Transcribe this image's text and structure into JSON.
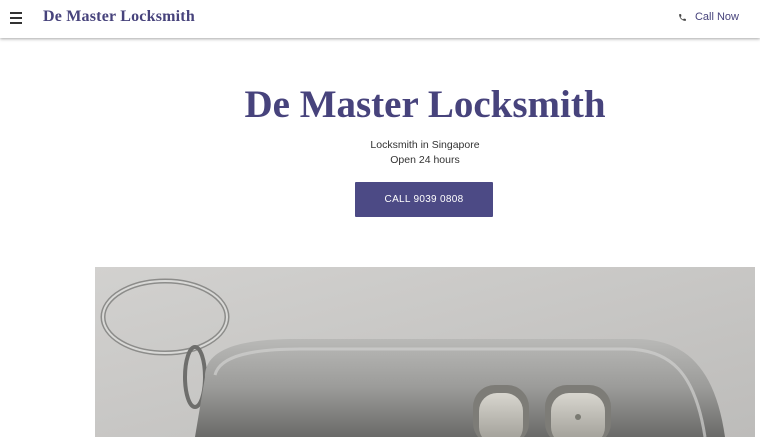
{
  "header": {
    "brand": "De Master Locksmith",
    "call_label": "Call Now",
    "menu_icon": "hamburger-menu-icon",
    "phone_icon": "phone-icon"
  },
  "hero": {
    "title": "De Master Locksmith",
    "subtitle": "Locksmith in Singapore",
    "hours": "Open 24 hours",
    "cta_label": "CALL 9039 0808"
  },
  "colors": {
    "accent": "#47437c",
    "button": "#4c4a85",
    "text": "#333333"
  }
}
